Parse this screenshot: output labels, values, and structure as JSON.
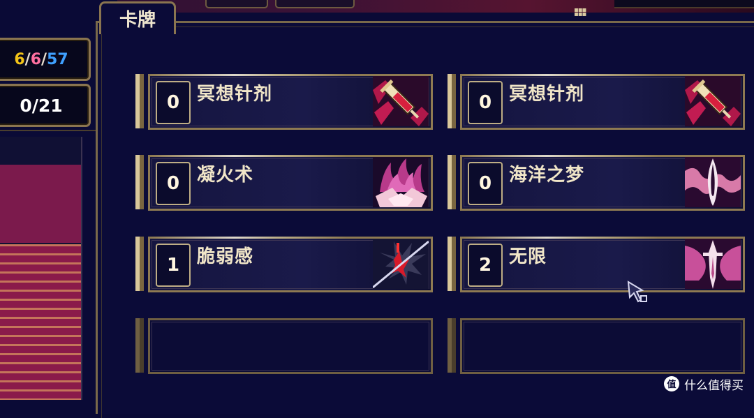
{
  "stats": {
    "resources": [
      "6",
      "6",
      "57"
    ],
    "resource_colors": [
      "#f2c318",
      "#ff6fa0",
      "#3fa0ff"
    ],
    "separator": "/",
    "progress": "0/21"
  },
  "tab": {
    "label": "卡牌"
  },
  "cards": [
    {
      "cost": "0",
      "name": "冥想针剂",
      "icon": "syringe-icon"
    },
    {
      "cost": "0",
      "name": "冥想针剂",
      "icon": "syringe-icon"
    },
    {
      "cost": "0",
      "name": "凝火术",
      "icon": "flame-icon"
    },
    {
      "cost": "0",
      "name": "海洋之梦",
      "icon": "ocean-dream-icon"
    },
    {
      "cost": "1",
      "name": "脆弱感",
      "icon": "shatter-icon"
    },
    {
      "cost": "2",
      "name": "无限",
      "icon": "infinity-sword-icon"
    }
  ],
  "watermark": {
    "text": "什么值得买"
  }
}
